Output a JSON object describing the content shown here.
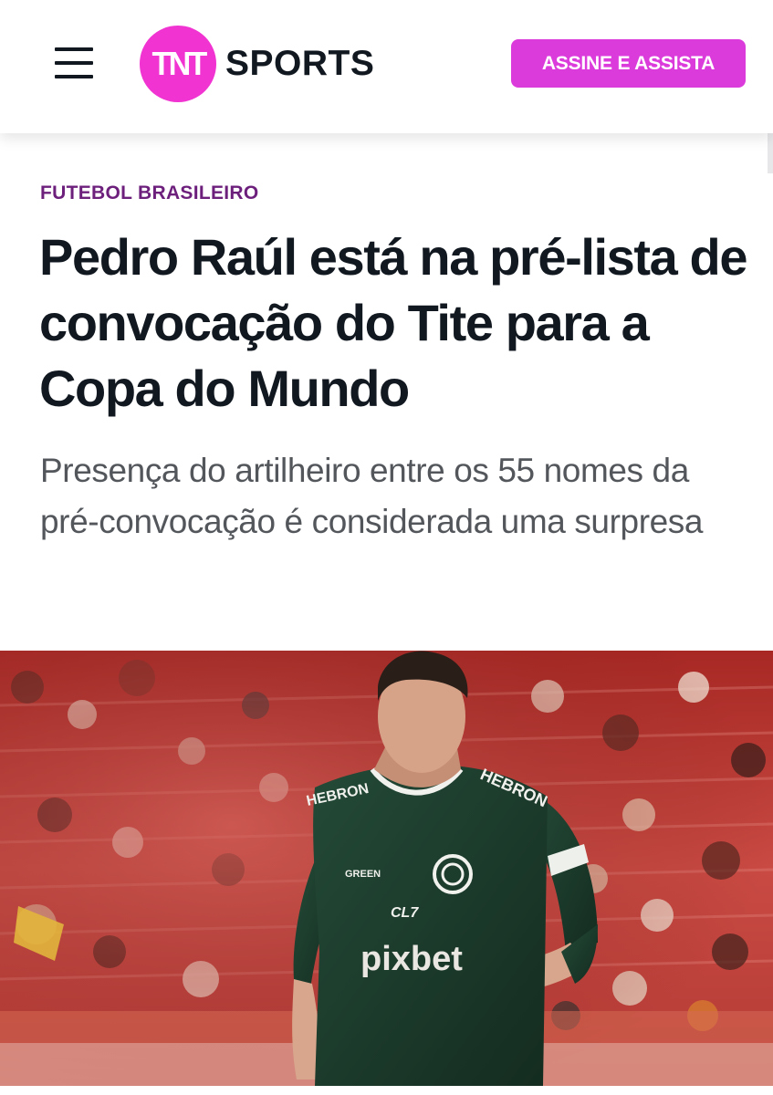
{
  "header": {
    "logo_mark": "TNT",
    "logo_text": "SPORTS",
    "cta_label": "ASSINE E ASSISTA"
  },
  "article": {
    "category": "FUTEBOL BRASILEIRO",
    "headline": "Pedro Raúl está na pré-lista de convocação do Tite para a Copa do Mundo",
    "subheadline": "Presença do artilheiro entre os 55 nomes da pré-convocação é considerada uma surpresa"
  },
  "photo": {
    "jersey_sponsors": [
      "HEBRON",
      "HEBRON",
      "CL7",
      "pixbet",
      "GREEN"
    ]
  },
  "colors": {
    "brand_magenta": "#f033d1",
    "cta_background": "#dc3bdc",
    "category_purple": "#6d1f7c",
    "headline_text": "#111820",
    "subhead_text": "#53575c",
    "jersey_green": "#1b3a2a",
    "stadium_red": "#b8302d"
  },
  "icons": {
    "menu": "hamburger-menu-icon"
  }
}
